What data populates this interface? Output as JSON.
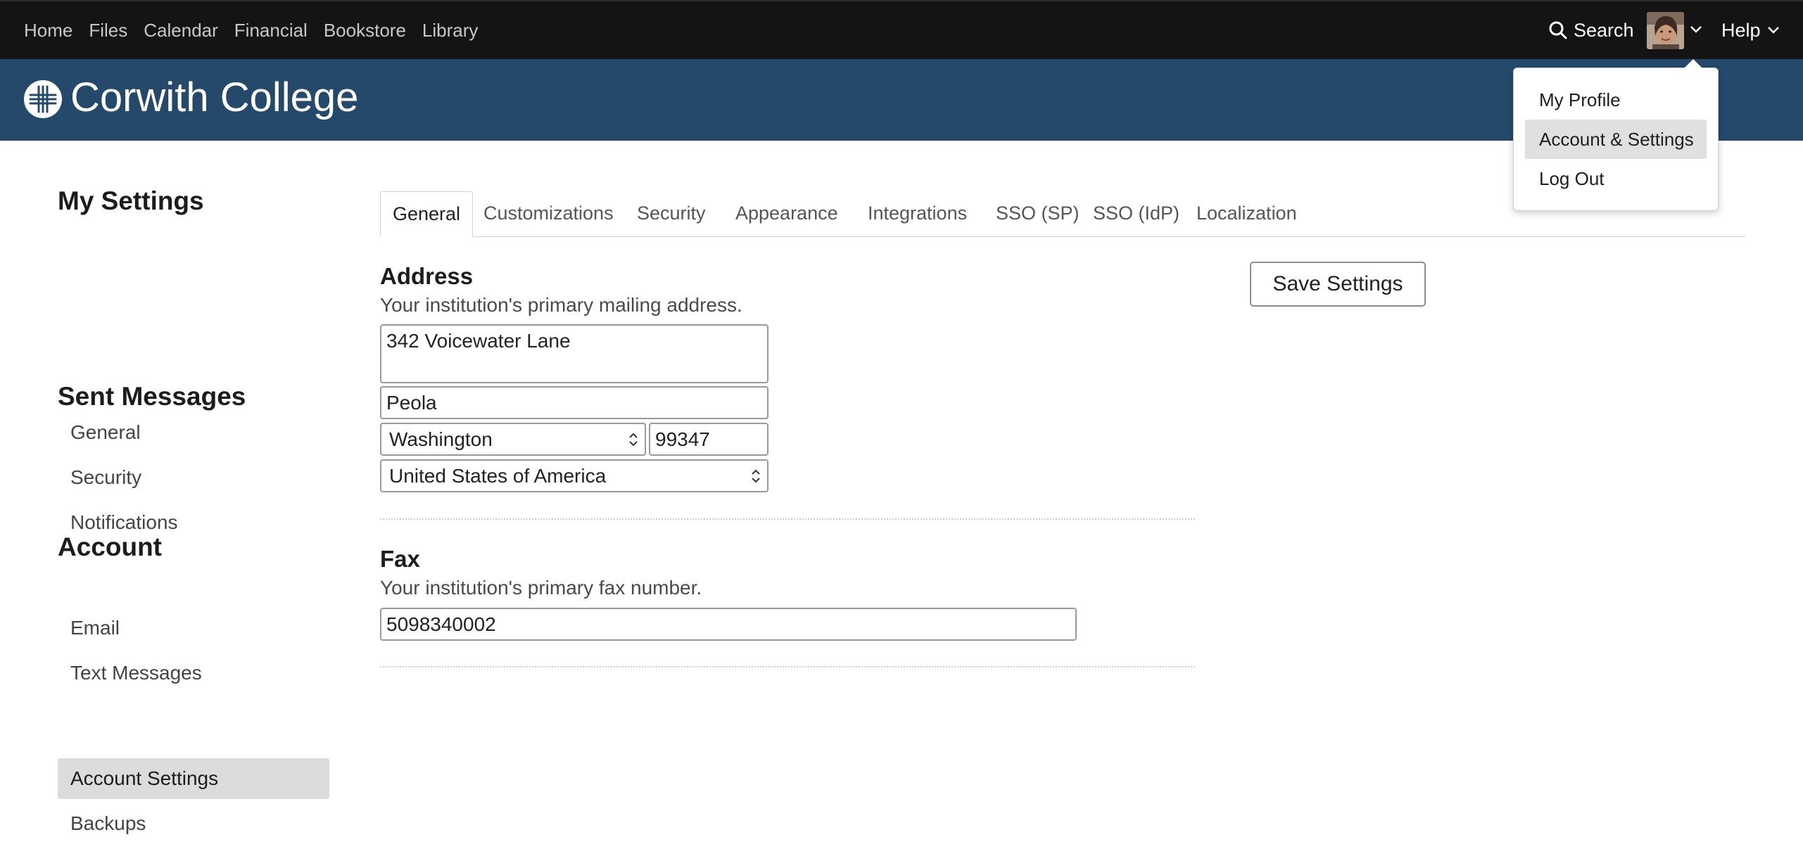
{
  "topnav": {
    "links": [
      "Home",
      "Files",
      "Calendar",
      "Financial",
      "Bookstore",
      "Library"
    ],
    "search_label": "Search",
    "help_label": "Help"
  },
  "brand": {
    "name": "Corwith College"
  },
  "user_menu": {
    "items": [
      {
        "label": "My Profile",
        "active": false
      },
      {
        "label": "Account & Settings",
        "active": true
      },
      {
        "label": "Log Out",
        "active": false
      }
    ]
  },
  "sidebar": {
    "sections": [
      {
        "heading": "My Settings",
        "items": [
          "General",
          "Security",
          "Notifications"
        ]
      },
      {
        "heading": "Sent Messages",
        "items": [
          "Email",
          "Text Messages"
        ]
      },
      {
        "heading": "Account",
        "items": [
          "Account Settings",
          "Backups"
        ]
      }
    ],
    "active_item": "Account Settings"
  },
  "tabs": {
    "items": [
      "General",
      "Customizations",
      "Security",
      "Appearance",
      "Integrations",
      "SSO (SP)",
      "SSO (IdP)",
      "Localization"
    ],
    "active": "General"
  },
  "address": {
    "title": "Address",
    "description": "Your institution's primary mailing address.",
    "street": "342 Voicewater Lane",
    "city": "Peola",
    "state": "Washington",
    "zip": "99347",
    "country": "United States of America"
  },
  "fax": {
    "title": "Fax",
    "description": "Your institution's primary fax number.",
    "number": "5098340002"
  },
  "actions": {
    "save_label": "Save Settings"
  },
  "colors": {
    "topnav_bg": "#141414",
    "banner_bg": "#24496b",
    "active_bg": "#dcdcdc"
  }
}
